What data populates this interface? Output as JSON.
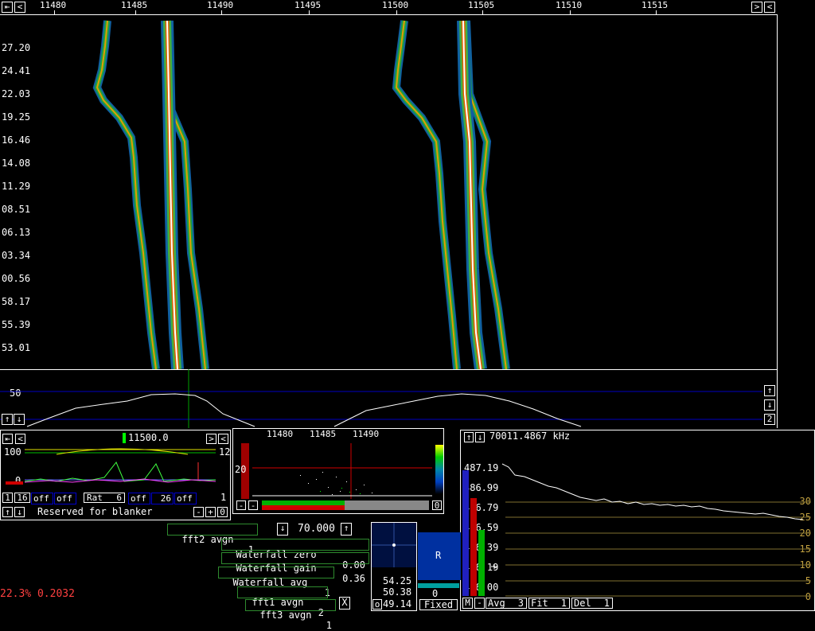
{
  "freq_axis": {
    "ticks": [
      "11480",
      "11485",
      "11490",
      "11495",
      "11500",
      "11505",
      "11510",
      "11515"
    ]
  },
  "time_axis": {
    "labels": [
      "27.20",
      "24.41",
      "22.03",
      "19.25",
      "16.46",
      "14.08",
      "11.29",
      "08.51",
      "06.13",
      "03.34",
      "00.56",
      "58.17",
      "55.39",
      "53.01"
    ]
  },
  "spectrum": {
    "scale_label": "50",
    "zoom_label": "2"
  },
  "baseband": {
    "freq_value": "11500.0",
    "y_top": "100",
    "y_zero": "0",
    "right_top": "12",
    "right_bottom": "1",
    "ctrl_a": "1",
    "ctrl_b": "16",
    "ctrl_off1": "off",
    "ctrl_off2": "off",
    "rat_label": "Rat",
    "rat_value": "6",
    "ctrl_off3": "off",
    "ctrl_26": "26",
    "ctrl_off4": "off",
    "blanker_text": "Reserved for blanker",
    "minus": "-",
    "plus": "+",
    "zero": "0"
  },
  "mini_spectrum": {
    "ticks": [
      "11480",
      "11485",
      "11490"
    ],
    "level": "20",
    "zero": "0"
  },
  "afc": {
    "freq_readout": "70011.4867 kHz",
    "y_labels": [
      "487.19",
      "486.99",
      "486.79",
      "486.59",
      "486.39",
      "486.19",
      "486.00"
    ],
    "right_labels": [
      "30",
      "25",
      "20",
      "15",
      "10",
      "5",
      "0"
    ],
    "m_label": "M",
    "minus": "-",
    "avg_label": "Avg",
    "avg_value": "3",
    "fit_label": "Fit",
    "fit_value": "1",
    "del_label": "Del",
    "del_value": "1"
  },
  "controls": {
    "fft2_avgn": "fft2 avgn",
    "fft2_avgn_val": "1",
    "freq_value": "70.000",
    "wf_zero": "Waterfall zero",
    "wf_zero_val": "0.00",
    "wf_gain": "Waterfall gain",
    "wf_gain_val": "0.36",
    "wf_avg": "Waterfall avg",
    "wf_avg_val": "1",
    "fft1_avgn": "fft1 avgn",
    "fft1_avgn_val": "2",
    "fft3_avgn": "fft3 avgn",
    "fft3_avgn_val": "1",
    "close": "X"
  },
  "smeter": {
    "r_label": "R",
    "v1": "54.25",
    "v2": "50.38",
    "v3": "49.14",
    "o_label": "o",
    "zero": "0",
    "mode": "Fixed"
  },
  "status": {
    "cpu": "22.3% 0.2032"
  },
  "colors": {
    "accent_red": "#d00000",
    "accent_green": "#00b000",
    "control_border": "#2e8b2e",
    "blue": "#0000c0"
  }
}
